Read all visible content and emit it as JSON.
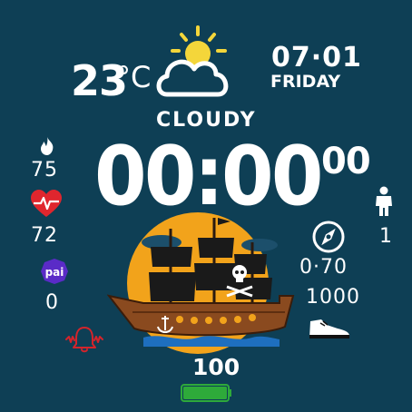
{
  "weather": {
    "temperature": "23",
    "unit": "°C",
    "condition": "CLOUDY"
  },
  "date": {
    "day_month": "07·01",
    "weekday": "FRIDAY"
  },
  "time": {
    "hours_minutes": "00:00",
    "seconds": "00"
  },
  "stats": {
    "calories": "75",
    "heart_rate": "72",
    "pai": "0",
    "people": "1",
    "distance": "0·70",
    "steps": "1000",
    "pai_label": "pai"
  },
  "battery": {
    "percent": "100",
    "level": 1.0,
    "color": "#2eaa3a"
  },
  "colors": {
    "background": "#0e3f55",
    "sun": "#f4d63a",
    "heart": "#e0262e",
    "pai_badge": "#5a2bc7",
    "alarm": "#d3242b",
    "moon_orange": "#f2a31b"
  }
}
